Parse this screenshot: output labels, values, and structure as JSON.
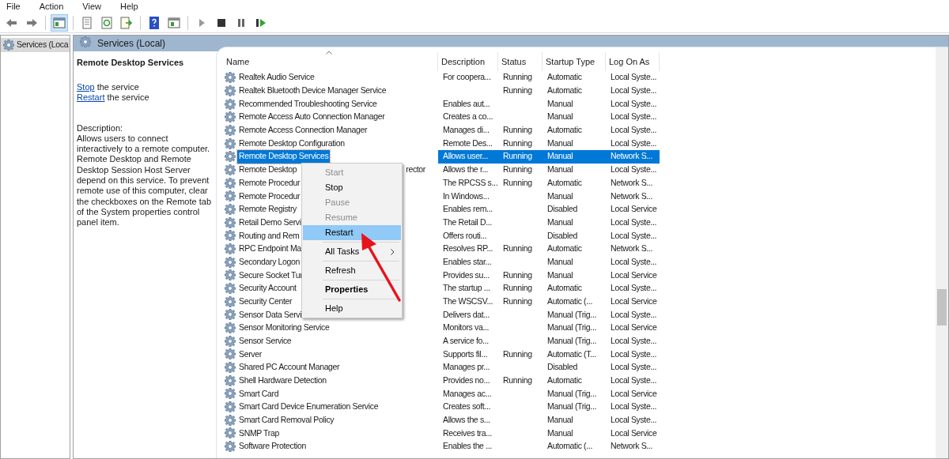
{
  "menu_bar": [
    "File",
    "Action",
    "View",
    "Help"
  ],
  "toolbar": [
    {
      "kind": "back",
      "pressed": false
    },
    {
      "kind": "forward",
      "pressed": false
    },
    {
      "kind": "separator"
    },
    {
      "kind": "tree",
      "pressed": true
    },
    {
      "kind": "separator"
    },
    {
      "kind": "properties",
      "pressed": false
    },
    {
      "kind": "refresh",
      "pressed": false
    },
    {
      "kind": "export",
      "pressed": false
    },
    {
      "kind": "separator"
    },
    {
      "kind": "help",
      "pressed": false
    },
    {
      "kind": "console",
      "pressed": false
    },
    {
      "kind": "separator"
    },
    {
      "kind": "play",
      "pressed": false
    },
    {
      "kind": "stop",
      "pressed": false
    },
    {
      "kind": "pause",
      "pressed": false
    },
    {
      "kind": "resume",
      "pressed": false
    }
  ],
  "tree": [
    {
      "label": "Services (Loca",
      "selected": true
    }
  ],
  "panel_title": "Services (Local)",
  "details": {
    "title": "Remote Desktop Services",
    "actions": [
      {
        "link": "Stop",
        "text": "the service"
      },
      {
        "link": "Restart",
        "text": "the service"
      }
    ],
    "description_label": "Description:",
    "description": "Allows users to connect interactively to a remote computer. Remote Desktop and Remote Desktop Session Host Server depend on this service. To prevent remote use of this computer, clear the checkboxes on the Remote tab of the System properties control panel item."
  },
  "table": {
    "columns": [
      {
        "label": "Name",
        "sorted": true
      },
      {
        "label": "Description",
        "sorted": false
      },
      {
        "label": "Status",
        "sorted": false
      },
      {
        "label": "Startup Type",
        "sorted": false
      },
      {
        "label": "Log On As",
        "sorted": false
      }
    ],
    "rows": [
      {
        "name": "Realtek Audio Service",
        "description": "For coopera...",
        "status": "Running",
        "startup_type": "Automatic",
        "log_on_as": "Local Syste...",
        "selected": false
      },
      {
        "name": "Realtek Bluetooth Device Manager Service",
        "status": "Running",
        "startup_type": "Automatic",
        "log_on_as": "Local Syste...",
        "selected": false
      },
      {
        "name": "Recommended Troubleshooting Service",
        "description": "Enables aut...",
        "startup_type": "Manual",
        "log_on_as": "Local Syste...",
        "selected": false
      },
      {
        "name": "Remote Access Auto Connection Manager",
        "description": "Creates a co...",
        "startup_type": "Manual",
        "log_on_as": "Local Syste...",
        "selected": false
      },
      {
        "name": "Remote Access Connection Manager",
        "description": "Manages di...",
        "status": "Running",
        "startup_type": "Automatic",
        "log_on_as": "Local Syste...",
        "selected": false
      },
      {
        "name": "Remote Desktop Configuration",
        "description": "Remote Des...",
        "status": "Running",
        "startup_type": "Manual",
        "log_on_as": "Local Syste...",
        "selected": false
      },
      {
        "name": "Remote Desktop Services",
        "description": "Allows user...",
        "status": "Running",
        "startup_type": "Manual",
        "log_on_as": "Network S...",
        "selected": true
      },
      {
        "name": "Remote Desktop",
        "name_tail": "rector",
        "description": "Allows the r...",
        "status": "Running",
        "startup_type": "Manual",
        "log_on_as": "Local Syste...",
        "selected": false
      },
      {
        "name": "Remote Procedur",
        "description": "The RPCSS s...",
        "status": "Running",
        "startup_type": "Automatic",
        "log_on_as": "Network S...",
        "selected": false
      },
      {
        "name": "Remote Procedur",
        "description": "In Windows...",
        "startup_type": "Manual",
        "log_on_as": "Network S...",
        "selected": false
      },
      {
        "name": "Remote Registry",
        "description": "Enables rem...",
        "startup_type": "Disabled",
        "log_on_as": "Local Service",
        "selected": false
      },
      {
        "name": "Retail Demo Servi",
        "description": "The Retail D...",
        "startup_type": "Manual",
        "log_on_as": "Local Syste...",
        "selected": false
      },
      {
        "name": "Routing and Rem",
        "description": "Offers routi...",
        "startup_type": "Disabled",
        "log_on_as": "Local Syste...",
        "selected": false
      },
      {
        "name": "RPC Endpoint Ma",
        "description": "Resolves RP...",
        "status": "Running",
        "startup_type": "Automatic",
        "log_on_as": "Network S...",
        "selected": false
      },
      {
        "name": "Secondary Logon",
        "description": "Enables star...",
        "startup_type": "Manual",
        "log_on_as": "Local Syste...",
        "selected": false
      },
      {
        "name": "Secure Socket Tur",
        "description": "Provides su...",
        "status": "Running",
        "startup_type": "Manual",
        "log_on_as": "Local Service",
        "selected": false
      },
      {
        "name": "Security Account",
        "description": "The startup ...",
        "status": "Running",
        "startup_type": "Automatic",
        "log_on_as": "Local Syste...",
        "selected": false
      },
      {
        "name": "Security Center",
        "description": "The WSCSV...",
        "status": "Running",
        "startup_type": "Automatic (...",
        "log_on_as": "Local Service",
        "selected": false
      },
      {
        "name": "Sensor Data Servi",
        "description": "Delivers dat...",
        "startup_type": "Manual (Trig...",
        "log_on_as": "Local Syste...",
        "selected": false
      },
      {
        "name": "Sensor Monitoring Service",
        "description": "Monitors va...",
        "startup_type": "Manual (Trig...",
        "log_on_as": "Local Service",
        "selected": false
      },
      {
        "name": "Sensor Service",
        "description": "A service fo...",
        "startup_type": "Manual (Trig...",
        "log_on_as": "Local Syste...",
        "selected": false
      },
      {
        "name": "Server",
        "description": "Supports fil...",
        "status": "Running",
        "startup_type": "Automatic (T...",
        "log_on_as": "Local Syste...",
        "selected": false
      },
      {
        "name": "Shared PC Account Manager",
        "description": "Manages pr...",
        "startup_type": "Disabled",
        "log_on_as": "Local Syste...",
        "selected": false
      },
      {
        "name": "Shell Hardware Detection",
        "description": "Provides no...",
        "status": "Running",
        "startup_type": "Automatic",
        "log_on_as": "Local Syste...",
        "selected": false
      },
      {
        "name": "Smart Card",
        "description": "Manages ac...",
        "startup_type": "Manual (Trig...",
        "log_on_as": "Local Service",
        "selected": false
      },
      {
        "name": "Smart Card Device Enumeration Service",
        "description": "Creates soft...",
        "startup_type": "Manual (Trig...",
        "log_on_as": "Local Syste...",
        "selected": false
      },
      {
        "name": "Smart Card Removal Policy",
        "description": "Allows the s...",
        "startup_type": "Manual",
        "log_on_as": "Local Syste...",
        "selected": false
      },
      {
        "name": "SNMP Trap",
        "description": "Receives tra...",
        "startup_type": "Manual",
        "log_on_as": "Local Service",
        "selected": false
      },
      {
        "name": "Software Protection",
        "description": "Enables the ...",
        "startup_type": "Automatic (...",
        "log_on_as": "Network S...",
        "selected": false
      }
    ]
  },
  "context_menu": {
    "items": [
      {
        "kind": "item",
        "label": "Start",
        "disabled": true,
        "selected": false,
        "default": false
      },
      {
        "kind": "item",
        "label": "Stop",
        "disabled": false,
        "selected": false,
        "default": false
      },
      {
        "kind": "item",
        "label": "Pause",
        "disabled": true,
        "selected": false,
        "default": false
      },
      {
        "kind": "item",
        "label": "Resume",
        "disabled": true,
        "selected": false,
        "default": false
      },
      {
        "kind": "item",
        "label": "Restart",
        "disabled": false,
        "selected": true,
        "default": false
      },
      {
        "kind": "separator"
      },
      {
        "kind": "submenu",
        "label": "All Tasks",
        "disabled": false,
        "selected": false,
        "default": false
      },
      {
        "kind": "separator"
      },
      {
        "kind": "item",
        "label": "Refresh",
        "disabled": false,
        "selected": false,
        "default": false
      },
      {
        "kind": "separator"
      },
      {
        "kind": "item",
        "label": "Properties",
        "disabled": false,
        "selected": false,
        "default": true
      },
      {
        "kind": "separator"
      },
      {
        "kind": "item",
        "label": "Help",
        "disabled": false,
        "selected": false,
        "default": false
      }
    ]
  }
}
